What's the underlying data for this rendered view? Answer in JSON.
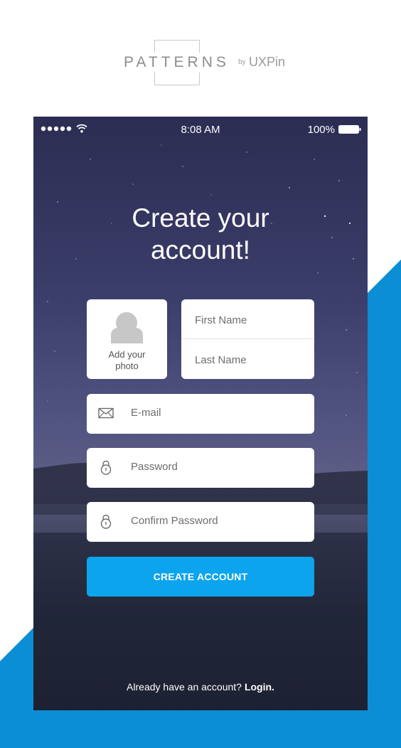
{
  "brand": {
    "name": "PATTERNS",
    "by": "by",
    "company": "UXPin"
  },
  "status_bar": {
    "time": "8:08 AM",
    "battery": "100%"
  },
  "screen": {
    "title_line1": "Create your",
    "title_line2": "account!",
    "photo_label_line1": "Add your",
    "photo_label_line2": "photo",
    "first_name_placeholder": "First Name",
    "last_name_placeholder": "Last Name",
    "email_placeholder": "E-mail",
    "password_placeholder": "Password",
    "confirm_password_placeholder": "Confirm Password",
    "create_button_label": "CREATE ACCOUNT",
    "login_prompt": "Already have an account?",
    "login_link": "Login."
  },
  "colors": {
    "accent": "#0ca4ec",
    "background_blue": "#0b8ed4"
  },
  "icons": [
    "signal-dots-icon",
    "wifi-icon",
    "battery-icon",
    "avatar-icon",
    "envelope-icon",
    "lock-icon"
  ]
}
